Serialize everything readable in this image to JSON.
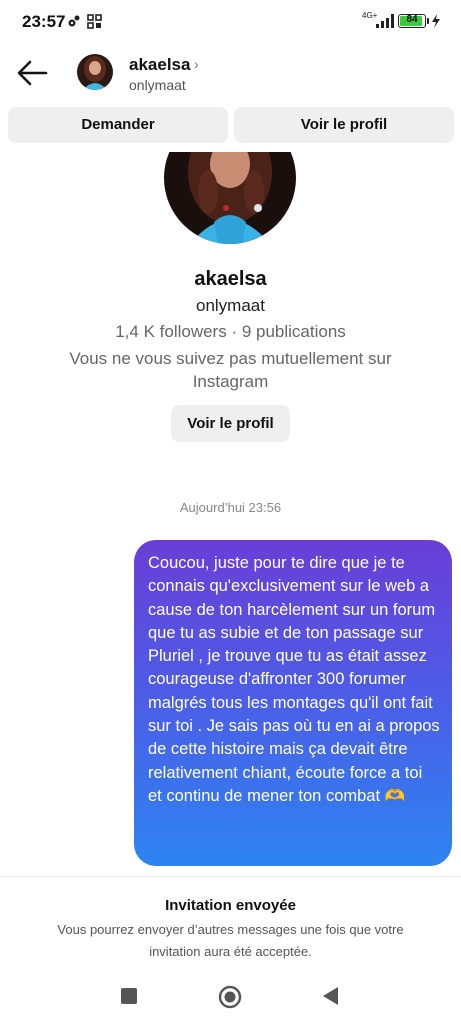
{
  "status_bar": {
    "time": "23:57",
    "network": "4G+",
    "battery": "84"
  },
  "header": {
    "username": "akaelsa",
    "handle": "onlymaat"
  },
  "actions": {
    "request_label": "Demander",
    "view_profile_label": "Voir le profil"
  },
  "profile": {
    "name": "akaelsa",
    "handle": "onlymaat",
    "stats": "1,4 K followers · 9 publications",
    "mutual_note": "Vous ne vous suivez pas mutuellement sur Instagram",
    "view_profile_label": "Voir le profil"
  },
  "thread": {
    "timestamp": "Aujourd’hui 23:56",
    "messages": [
      {
        "from": "me",
        "text": "Coucou, juste pour te dire que je te connais qu'exclusivement sur le web a cause de ton harcèlement sur un forum que tu as subie et de ton passage sur Pluriel , je trouve que tu as était assez courageuse d'affronter 300 forumer malgrés tous les montages qu'il ont fait sur toi . Je sais pas où tu en ai a propos de cette histoire mais ça devait être relativement chiant, écoute force a toi et continu de mener ton combat 🫶"
      }
    ]
  },
  "invitation": {
    "title": "Invitation envoyée",
    "text": "Vous pourrez envoyer d’autres messages une fois que votre invitation aura été acceptée."
  },
  "colors": {
    "bubble_top": "#6a3ed6",
    "bubble_bottom": "#2d84f1",
    "button_bg": "#efeff0",
    "battery_green": "#3ec93e"
  }
}
